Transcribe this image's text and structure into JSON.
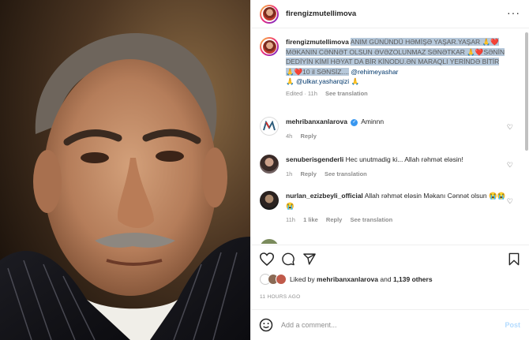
{
  "post": {
    "author": "firengizmutellimova",
    "avatar_icon": "avatar-woman-red-hair"
  },
  "caption": {
    "author": "firengizmutellimova",
    "text_highlighted": "ANIM GÜNÜNDÜ HƏMİŞƏ YAŞAR.YAŞAR 🙏❤️ MƏKANIN CƏNNƏT OLSUN ƏVƏZOLUNMAZ SƏNƏTKAR 🙏❤️SƏNİN DEDİYİN KİMİ HƏYAT DA BİR KİNODU.ƏN MARAQLI YERİNDƏ BİTİR🙏❤️10 il SƏNSİZ....",
    "mention1": "@rehimeyashar",
    "emoji": "🙏",
    "mention2": "@ulkar.yasharqizi",
    "emoji2": "🙏",
    "edited": "Edited · 11h",
    "see_translation": "See translation"
  },
  "comments": [
    {
      "username": "mehribanxanlarova",
      "verified": true,
      "text": "Aminnn",
      "time": "4h",
      "reply": "Reply",
      "avatar_color": "#ffffff",
      "avatar_icon": "m-logo-avatar"
    },
    {
      "username": "senuberisgenderli",
      "text": "Hec unutmadig ki... Allah rəhmət eləsin!",
      "time": "1h",
      "reply": "Reply",
      "see_translation": "See translation",
      "avatar_icon": "avatar-woman"
    },
    {
      "username": "nurlan_ezizbeyli_official",
      "text": "Allah rəhmət eləsin Məkanı Cənnət olsun 😭😭😭",
      "time": "11h",
      "likes": "1 like",
      "reply": "Reply",
      "see_translation": "See translation",
      "avatar_icon": "avatar-man"
    }
  ],
  "actions": {
    "like_icon": "heart-icon",
    "comment_icon": "comment-icon",
    "share_icon": "share-icon",
    "save_icon": "bookmark-icon"
  },
  "likes": {
    "liked_by": "Liked by",
    "user": "mehribanxanlarova",
    "and": "and",
    "count": "1,139 others"
  },
  "timestamp": "11 HOURS AGO",
  "add_comment": {
    "placeholder": "Add a comment...",
    "post_label": "Post"
  },
  "colors": {
    "highlight": "#b6c8da",
    "link": "#00376b",
    "verified": "#3897f0",
    "post_disabled": "#b3dbff"
  }
}
